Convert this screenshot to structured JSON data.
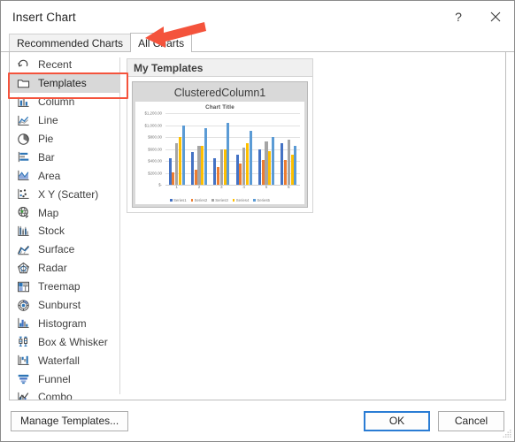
{
  "window": {
    "title": "Insert Chart",
    "help_label": "?",
    "close_label": "✕"
  },
  "tabs": [
    {
      "label": "Recommended Charts",
      "active": false
    },
    {
      "label": "All Charts",
      "active": true
    }
  ],
  "sidebar": {
    "items": [
      {
        "label": "Recent",
        "icon": "recent-icon",
        "selected": false
      },
      {
        "label": "Templates",
        "icon": "templates-icon",
        "selected": true
      },
      {
        "label": "Column",
        "icon": "column-icon",
        "selected": false
      },
      {
        "label": "Line",
        "icon": "line-icon",
        "selected": false
      },
      {
        "label": "Pie",
        "icon": "pie-icon",
        "selected": false
      },
      {
        "label": "Bar",
        "icon": "bar-icon",
        "selected": false
      },
      {
        "label": "Area",
        "icon": "area-icon",
        "selected": false
      },
      {
        "label": "X Y (Scatter)",
        "icon": "scatter-icon",
        "selected": false
      },
      {
        "label": "Map",
        "icon": "map-icon",
        "selected": false
      },
      {
        "label": "Stock",
        "icon": "stock-icon",
        "selected": false
      },
      {
        "label": "Surface",
        "icon": "surface-icon",
        "selected": false
      },
      {
        "label": "Radar",
        "icon": "radar-icon",
        "selected": false
      },
      {
        "label": "Treemap",
        "icon": "treemap-icon",
        "selected": false
      },
      {
        "label": "Sunburst",
        "icon": "sunburst-icon",
        "selected": false
      },
      {
        "label": "Histogram",
        "icon": "histogram-icon",
        "selected": false
      },
      {
        "label": "Box & Whisker",
        "icon": "box-whisker-icon",
        "selected": false
      },
      {
        "label": "Waterfall",
        "icon": "waterfall-icon",
        "selected": false
      },
      {
        "label": "Funnel",
        "icon": "funnel-icon",
        "selected": false
      },
      {
        "label": "Combo",
        "icon": "combo-icon",
        "selected": false
      }
    ]
  },
  "main": {
    "group_header": "My Templates",
    "template_name": "ClusteredColumn1"
  },
  "footer": {
    "manage_label": "Manage Templates...",
    "ok_label": "OK",
    "cancel_label": "Cancel"
  },
  "annotations": {
    "highlight_color": "#f4533c",
    "arrow_target": "All Charts",
    "box_target": "Templates"
  },
  "chart_data": {
    "type": "bar",
    "title": "Chart Title",
    "xlabel": "",
    "ylabel": "",
    "ylim": [
      0,
      1200
    ],
    "grid": true,
    "legend_position": "bottom",
    "categories": [
      "1",
      "2",
      "3",
      "4",
      "5",
      "6"
    ],
    "ytick_labels": [
      "$1,200.00",
      "$1,000.00",
      "$800.00",
      "$600.00",
      "$400.00",
      "$200.00",
      "$-"
    ],
    "yticks": [
      1200,
      1000,
      800,
      600,
      400,
      200,
      0
    ],
    "series": [
      {
        "name": "Series1",
        "color": "#4472C4",
        "values": [
          450,
          550,
          440,
          500,
          600,
          700
        ]
      },
      {
        "name": "Series2",
        "color": "#ED7D31",
        "values": [
          210,
          250,
          300,
          360,
          410,
          410
        ]
      },
      {
        "name": "Series3",
        "color": "#A5A5A5",
        "values": [
          700,
          650,
          600,
          620,
          720,
          750
        ]
      },
      {
        "name": "Series4",
        "color": "#FFC000",
        "values": [
          800,
          650,
          600,
          700,
          560,
          500
        ]
      },
      {
        "name": "Series5",
        "color": "#5B9BD5",
        "values": [
          1000,
          950,
          1040,
          900,
          800,
          650
        ]
      }
    ]
  }
}
